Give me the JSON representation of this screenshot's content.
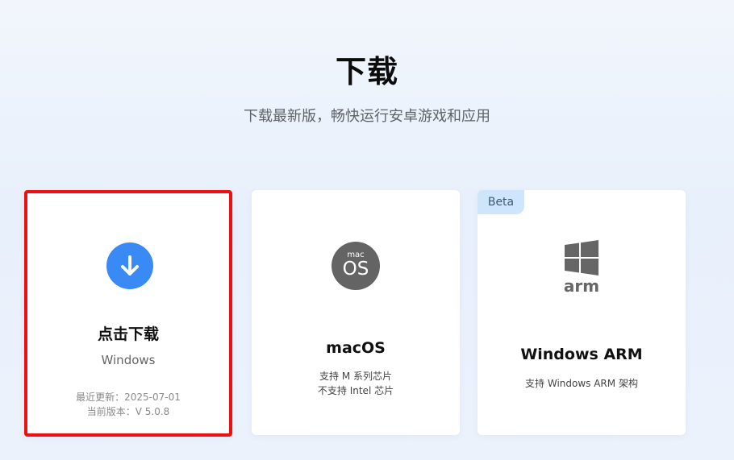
{
  "header": {
    "title": "下载",
    "subtitle": "下载最新版，畅快运行安卓游戏和应用"
  },
  "cards": {
    "windows": {
      "title": "点击下载",
      "platform": "Windows",
      "updated": "最近更新：2025-07-01",
      "version": "当前版本：V 5.0.8",
      "icon": "download-arrow-icon",
      "highlight_color": "#ee1010",
      "accent": "#3a8af6"
    },
    "macos": {
      "title": "macOS",
      "icon_small": "mac",
      "icon_big": "OS",
      "desc_line1": "支持 M 系列芯片",
      "desc_line2": "不支持 Intel 芯片"
    },
    "windows_arm": {
      "badge": "Beta",
      "title": "Windows ARM",
      "desc": "支持 Windows ARM 架构",
      "icon_text": "arm"
    }
  }
}
